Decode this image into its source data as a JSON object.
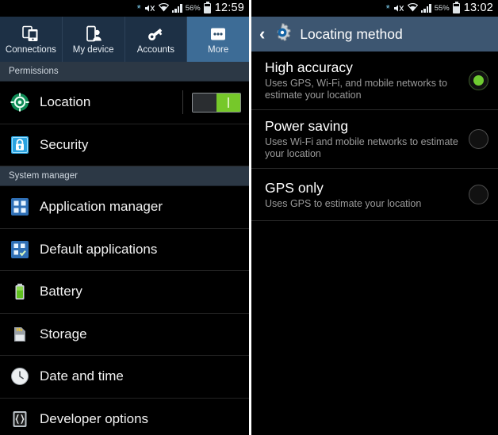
{
  "left": {
    "statusbar": {
      "bluetooth_icon": "bluetooth-icon",
      "mute_icon": "sound-muted-icon",
      "wifi_icon": "wifi-icon",
      "signal_icon": "cellular-signal-icon",
      "battery_percent": "56%",
      "battery_icon": "battery-icon",
      "time": "12:59"
    },
    "tabs": [
      {
        "label": "Connections",
        "icon": "connections-icon",
        "active": false
      },
      {
        "label": "My device",
        "icon": "my-device-icon",
        "active": false
      },
      {
        "label": "Accounts",
        "icon": "accounts-icon",
        "active": false
      },
      {
        "label": "More",
        "icon": "more-dots-icon",
        "active": true
      }
    ],
    "sections": [
      {
        "header": "Permissions",
        "rows": [
          {
            "label": "Location",
            "icon": "location-target-icon",
            "toggle": "on",
            "toggle_state": "ON"
          },
          {
            "label": "Security",
            "icon": "security-lock-icon"
          }
        ]
      },
      {
        "header": "System manager",
        "rows": [
          {
            "label": "Application manager",
            "icon": "application-manager-icon"
          },
          {
            "label": "Default applications",
            "icon": "default-applications-icon"
          },
          {
            "label": "Battery",
            "icon": "battery-settings-icon"
          },
          {
            "label": "Storage",
            "icon": "storage-sdcard-icon"
          },
          {
            "label": "Date and time",
            "icon": "clock-icon"
          },
          {
            "label": "Developer options",
            "icon": "developer-braces-icon"
          }
        ]
      }
    ]
  },
  "right": {
    "statusbar": {
      "bluetooth_icon": "bluetooth-icon",
      "mute_icon": "sound-muted-icon",
      "wifi_icon": "wifi-icon",
      "signal_icon": "cellular-signal-icon",
      "battery_percent": "55%",
      "battery_icon": "battery-icon",
      "time": "13:02"
    },
    "titlebar": {
      "back_icon": "back-chevron-icon",
      "app_icon": "settings-gear-icon",
      "title": "Locating method"
    },
    "options": [
      {
        "title": "High accuracy",
        "desc": "Uses GPS, Wi-Fi, and mobile networks to estimate your location",
        "selected": true
      },
      {
        "title": "Power saving",
        "desc": "Uses Wi-Fi and mobile networks to estimate your location",
        "selected": false
      },
      {
        "title": "GPS only",
        "desc": "Uses GPS to estimate your location",
        "selected": false
      }
    ]
  },
  "colors": {
    "accent_blue": "#3d6c96",
    "titlebar_blue": "#3d5671",
    "tabbar_blue": "#1d3045",
    "section_header": "#2c3845",
    "toggle_green": "#76c82a",
    "radio_green": "#6fcc31",
    "background": "#000000"
  }
}
